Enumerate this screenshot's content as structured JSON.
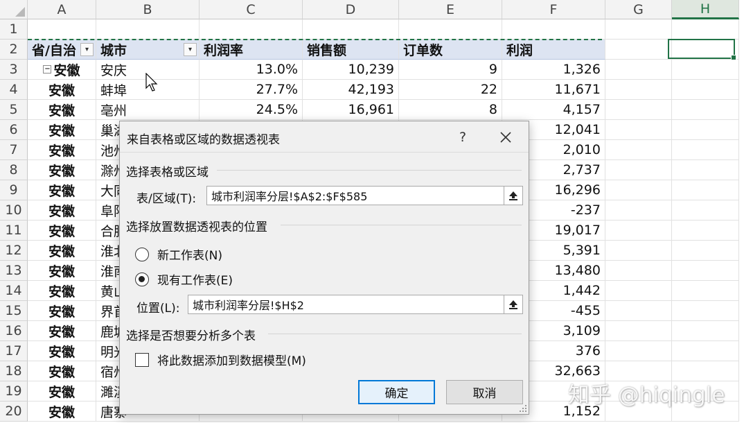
{
  "sheet": {
    "columns": [
      "",
      "A",
      "B",
      "C",
      "D",
      "E",
      "F",
      "G",
      "H"
    ],
    "header": [
      "省/自治",
      "城市",
      "利润率",
      "销售额",
      "订单数",
      "利润"
    ],
    "rows": [
      {
        "n": "1",
        "cells": [
          "",
          "",
          "",
          "",
          "",
          ""
        ]
      },
      {
        "n": "2",
        "cells": [
          "省/自治",
          "城市",
          "利润率",
          "销售额",
          "订单数",
          "利润"
        ]
      },
      {
        "n": "3",
        "cells": [
          "安徽",
          "安庆",
          "13.0%",
          "10,239",
          "9",
          "1,326"
        ]
      },
      {
        "n": "4",
        "cells": [
          "安徽",
          "蚌埠",
          "27.7%",
          "42,193",
          "22",
          "11,671"
        ]
      },
      {
        "n": "5",
        "cells": [
          "安徽",
          "亳州",
          "24.5%",
          "16,961",
          "8",
          "4,157"
        ]
      },
      {
        "n": "6",
        "cells": [
          "安徽",
          "巢湖",
          "",
          "",
          "",
          "12,041"
        ]
      },
      {
        "n": "7",
        "cells": [
          "安徽",
          "池州",
          "",
          "",
          "",
          "2,010"
        ]
      },
      {
        "n": "8",
        "cells": [
          "安徽",
          "滁州",
          "",
          "",
          "",
          "2,737"
        ]
      },
      {
        "n": "9",
        "cells": [
          "安徽",
          "大同",
          "",
          "",
          "",
          "16,296"
        ]
      },
      {
        "n": "10",
        "cells": [
          "安徽",
          "阜阳",
          "",
          "",
          "",
          "-237"
        ]
      },
      {
        "n": "11",
        "cells": [
          "安徽",
          "合肥",
          "",
          "",
          "",
          "19,017"
        ]
      },
      {
        "n": "12",
        "cells": [
          "安徽",
          "淮北",
          "",
          "",
          "",
          "5,391"
        ]
      },
      {
        "n": "13",
        "cells": [
          "安徽",
          "淮南",
          "",
          "",
          "",
          "13,480"
        ]
      },
      {
        "n": "14",
        "cells": [
          "安徽",
          "黄山",
          "",
          "",
          "",
          "1,442"
        ]
      },
      {
        "n": "15",
        "cells": [
          "安徽",
          "界首",
          "",
          "",
          "",
          "-455"
        ]
      },
      {
        "n": "16",
        "cells": [
          "安徽",
          "鹿城",
          "",
          "",
          "",
          "3,109"
        ]
      },
      {
        "n": "17",
        "cells": [
          "安徽",
          "明光",
          "",
          "",
          "",
          "376"
        ]
      },
      {
        "n": "18",
        "cells": [
          "安徽",
          "宿州",
          "",
          "",
          "",
          "32,663"
        ]
      },
      {
        "n": "19",
        "cells": [
          "安徽",
          "濉溪",
          "",
          "",
          "",
          ""
        ]
      },
      {
        "n": "20",
        "cells": [
          "安徽",
          "唐寨",
          "",
          "",
          "",
          "1,152"
        ]
      }
    ],
    "colors": {
      "accent": "#217346",
      "header_fill": "#dde4f2"
    }
  },
  "dialog": {
    "title": "来自表格或区域的数据透视表",
    "help": "?",
    "close": "✕",
    "section_source": "选择表格或区域",
    "range_label": "表/区域(T):",
    "range_value": "城市利润率分层!$A$2:$F$585",
    "section_location": "选择放置数据透视表的位置",
    "radio_new": "新工作表(N)",
    "radio_existing": "现有工作表(E)",
    "location_label": "位置(L):",
    "location_value": "城市利润率分层!$H$2",
    "section_multi": "选择是否想要分析多个表",
    "checkbox_model": "将此数据添加到数据模型(M)",
    "ok": "确定",
    "cancel": "取消"
  },
  "watermark": "知乎 @hiqingle"
}
